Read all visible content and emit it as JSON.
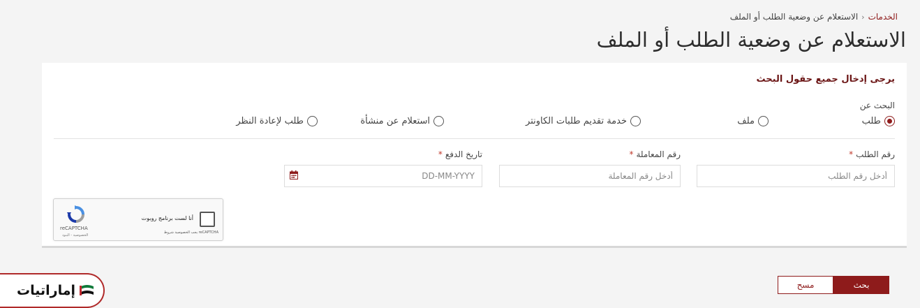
{
  "breadcrumb": {
    "home": "الخدمات",
    "separator": "‹",
    "current": "الاستعلام عن وضعية الطلب أو الملف"
  },
  "page": {
    "title": "الاستعلام عن وضعية الطلب أو الملف"
  },
  "form": {
    "instructions": "يرجى إدخال جميع حقول البحث",
    "search_by_label": "البحث عن",
    "options": [
      {
        "label": "طلب",
        "checked": true
      },
      {
        "label": "ملف",
        "checked": false
      },
      {
        "label": "خدمة تقديم طلبات الكاونتر",
        "checked": false
      },
      {
        "label": "استعلام عن منشأة",
        "checked": false
      },
      {
        "label": "طلب لإعادة النظر",
        "checked": false
      }
    ],
    "required_marker": "*",
    "fields": {
      "application_number": {
        "label": "رقم الطلب",
        "placeholder": "أدخل رقم الطلب",
        "value": ""
      },
      "transaction_number": {
        "label": "رقم المعاملة",
        "placeholder": "أدخل رقم المعاملة",
        "value": ""
      },
      "payment_date": {
        "label": "تاريخ الدفع",
        "placeholder": "DD-MM-YYYY",
        "value": "",
        "icon": "calendar-icon"
      }
    }
  },
  "recaptcha": {
    "label": "أنا لست برنامج روبوت",
    "brand": "reCAPTCHA",
    "privacy_note": "reCAPTCHA يجب الخصوصية شروط",
    "terms": "الخصوصية - البنود"
  },
  "actions": {
    "search_label": "بحث",
    "clear_label": "مسح"
  },
  "brand": {
    "name": "إماراتيات",
    "icon": "uae-flag-icon"
  },
  "colors": {
    "accent": "#8e1b1b",
    "required": "#c0392b",
    "background": "#f4f4f4"
  }
}
